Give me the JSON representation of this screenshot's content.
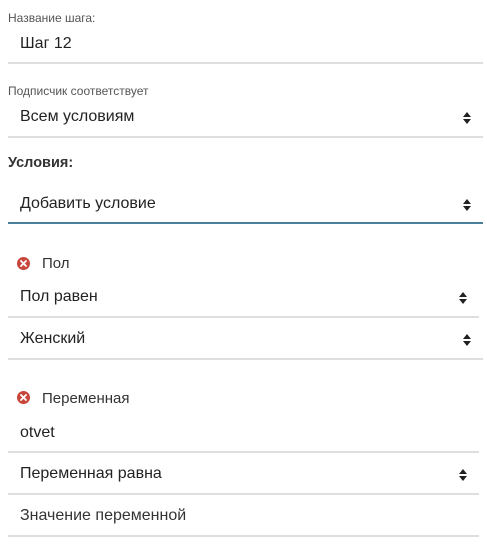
{
  "step_name": {
    "label": "Название шага:",
    "value": "Шаг 12"
  },
  "subscriber_match": {
    "label": "Подписчик соответствует",
    "selected": "Всем условиям"
  },
  "conditions": {
    "title": "Условия:",
    "add_select": "Добавить условие",
    "items": [
      {
        "title": "Пол",
        "operator": "Пол равен",
        "value": "Женский"
      },
      {
        "title": "Переменная",
        "variable_name": "otvet",
        "operator": "Переменная равна",
        "value_placeholder": "Значение переменной"
      }
    ]
  },
  "colors": {
    "accent_underline": "#4a7f9c",
    "remove_icon": "#c9463d",
    "divider": "#dedede"
  },
  "icons": {
    "select_arrows": "sort-arrows-icon",
    "remove": "remove-circle-icon"
  }
}
